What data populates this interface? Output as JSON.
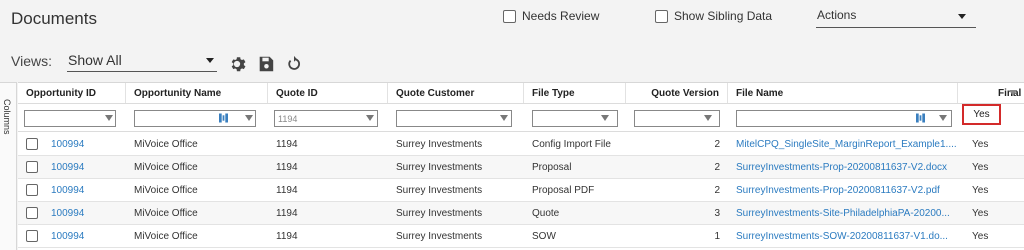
{
  "page": {
    "title": "Documents"
  },
  "toolbar": {
    "needs_review_label": "Needs Review",
    "show_sibling_label": "Show Sibling Data",
    "actions_label": "Actions",
    "views_label": "Views:",
    "views_value": "Show All"
  },
  "side_panel": {
    "label": "Columns"
  },
  "grid": {
    "columns": [
      {
        "key": "opportunity_id",
        "label": "Opportunity ID"
      },
      {
        "key": "opportunity_name",
        "label": "Opportunity Name"
      },
      {
        "key": "quote_id",
        "label": "Quote ID"
      },
      {
        "key": "quote_customer",
        "label": "Quote Customer"
      },
      {
        "key": "file_type",
        "label": "File Type"
      },
      {
        "key": "quote_version",
        "label": "Quote Version"
      },
      {
        "key": "file_name",
        "label": "File Name"
      },
      {
        "key": "final",
        "label": "Final"
      }
    ],
    "filters": {
      "quote_id": "1194",
      "final": "Yes"
    },
    "rows": [
      {
        "opportunity_id": "100994",
        "opportunity_name": "MiVoice Office",
        "quote_id": "1194",
        "quote_customer": "Surrey Investments",
        "file_type": "Config Import File",
        "quote_version": "2",
        "file_name": "MitelCPQ_SingleSite_MarginReport_Example1....",
        "final": "Yes"
      },
      {
        "opportunity_id": "100994",
        "opportunity_name": "MiVoice Office",
        "quote_id": "1194",
        "quote_customer": "Surrey Investments",
        "file_type": "Proposal",
        "quote_version": "2",
        "file_name": "SurreyInvestments-Prop-20200811637-V2.docx",
        "final": "Yes"
      },
      {
        "opportunity_id": "100994",
        "opportunity_name": "MiVoice Office",
        "quote_id": "1194",
        "quote_customer": "Surrey Investments",
        "file_type": "Proposal PDF",
        "quote_version": "2",
        "file_name": "SurreyInvestments-Prop-20200811637-V2.pdf",
        "final": "Yes"
      },
      {
        "opportunity_id": "100994",
        "opportunity_name": "MiVoice Office",
        "quote_id": "1194",
        "quote_customer": "Surrey Investments",
        "file_type": "Quote",
        "quote_version": "3",
        "file_name": "SurreyInvestments-Site-PhiladelphiaPA-20200...",
        "final": "Yes"
      },
      {
        "opportunity_id": "100994",
        "opportunity_name": "MiVoice Office",
        "quote_id": "1194",
        "quote_customer": "Surrey Investments",
        "file_type": "SOW",
        "quote_version": "1",
        "file_name": "SurreyInvestments-SOW-20200811637-V1.do...",
        "final": "Yes"
      }
    ]
  },
  "colors": {
    "link": "#2b7bc0",
    "highlight_border": "#d32a2a"
  }
}
